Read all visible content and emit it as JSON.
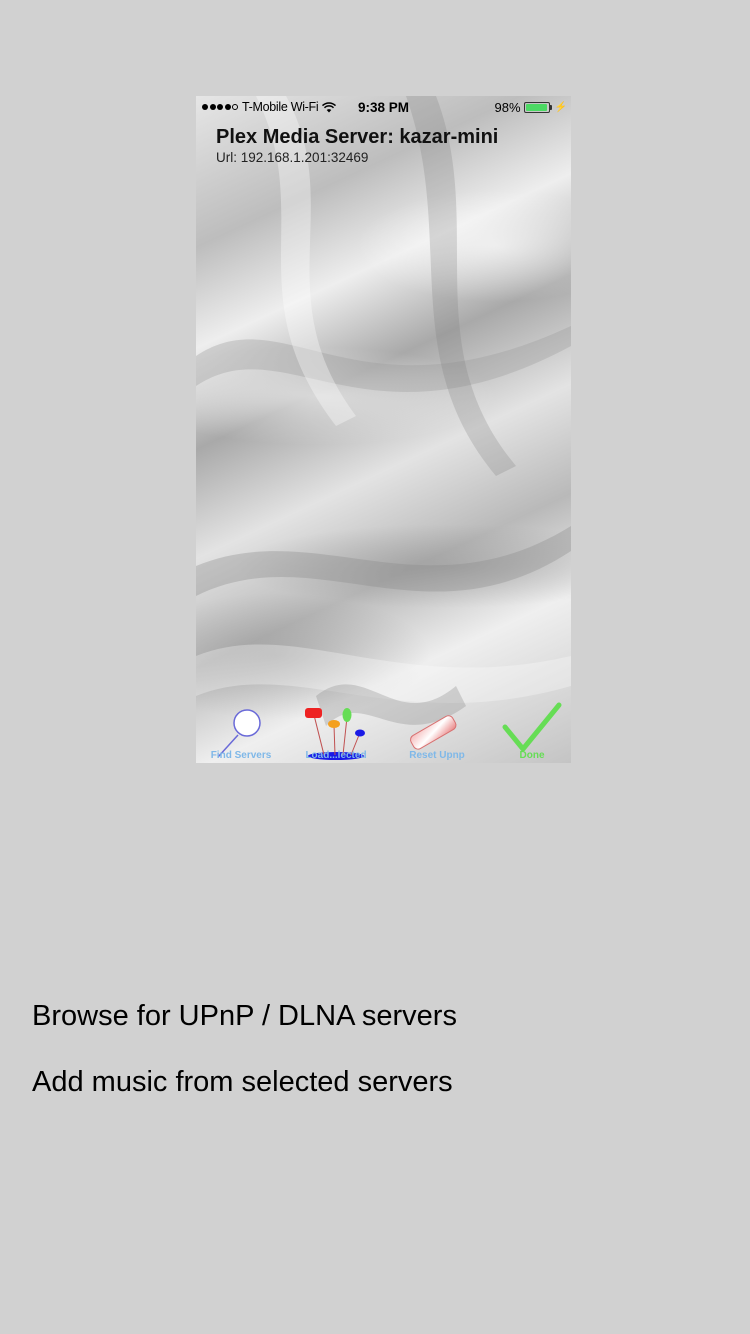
{
  "status_bar": {
    "carrier": "T-Mobile Wi-Fi",
    "time": "9:38 PM",
    "battery": "98%",
    "battery_level": 0.98,
    "signal_bars": 4,
    "signal_total": 5,
    "icons": [
      "wifi-icon",
      "battery-icon",
      "charging-bolt-icon"
    ]
  },
  "header": {
    "title": "Plex Media Server: kazar-mini",
    "url": "Url: 192.168.1.201:32469"
  },
  "toolbar": {
    "items": [
      {
        "label": "Find Servers",
        "icon": "magnifier-icon",
        "color": "#7fb8e8"
      },
      {
        "label": "Load...lected",
        "icon": "pins-icon",
        "color": "#7fb8e8"
      },
      {
        "label": "Reset Upnp",
        "icon": "eraser-icon",
        "color": "#7fb8e8"
      },
      {
        "label": "Done",
        "icon": "checkmark-icon",
        "color": "#66dd55"
      }
    ]
  },
  "captions": {
    "line1": "Browse for UPnP / DLNA servers",
    "line2": "Add music from selected servers"
  },
  "colors": {
    "page_bg": "#d1d1d1",
    "check": "#66dd55",
    "label_blue": "#7fb8e8"
  }
}
